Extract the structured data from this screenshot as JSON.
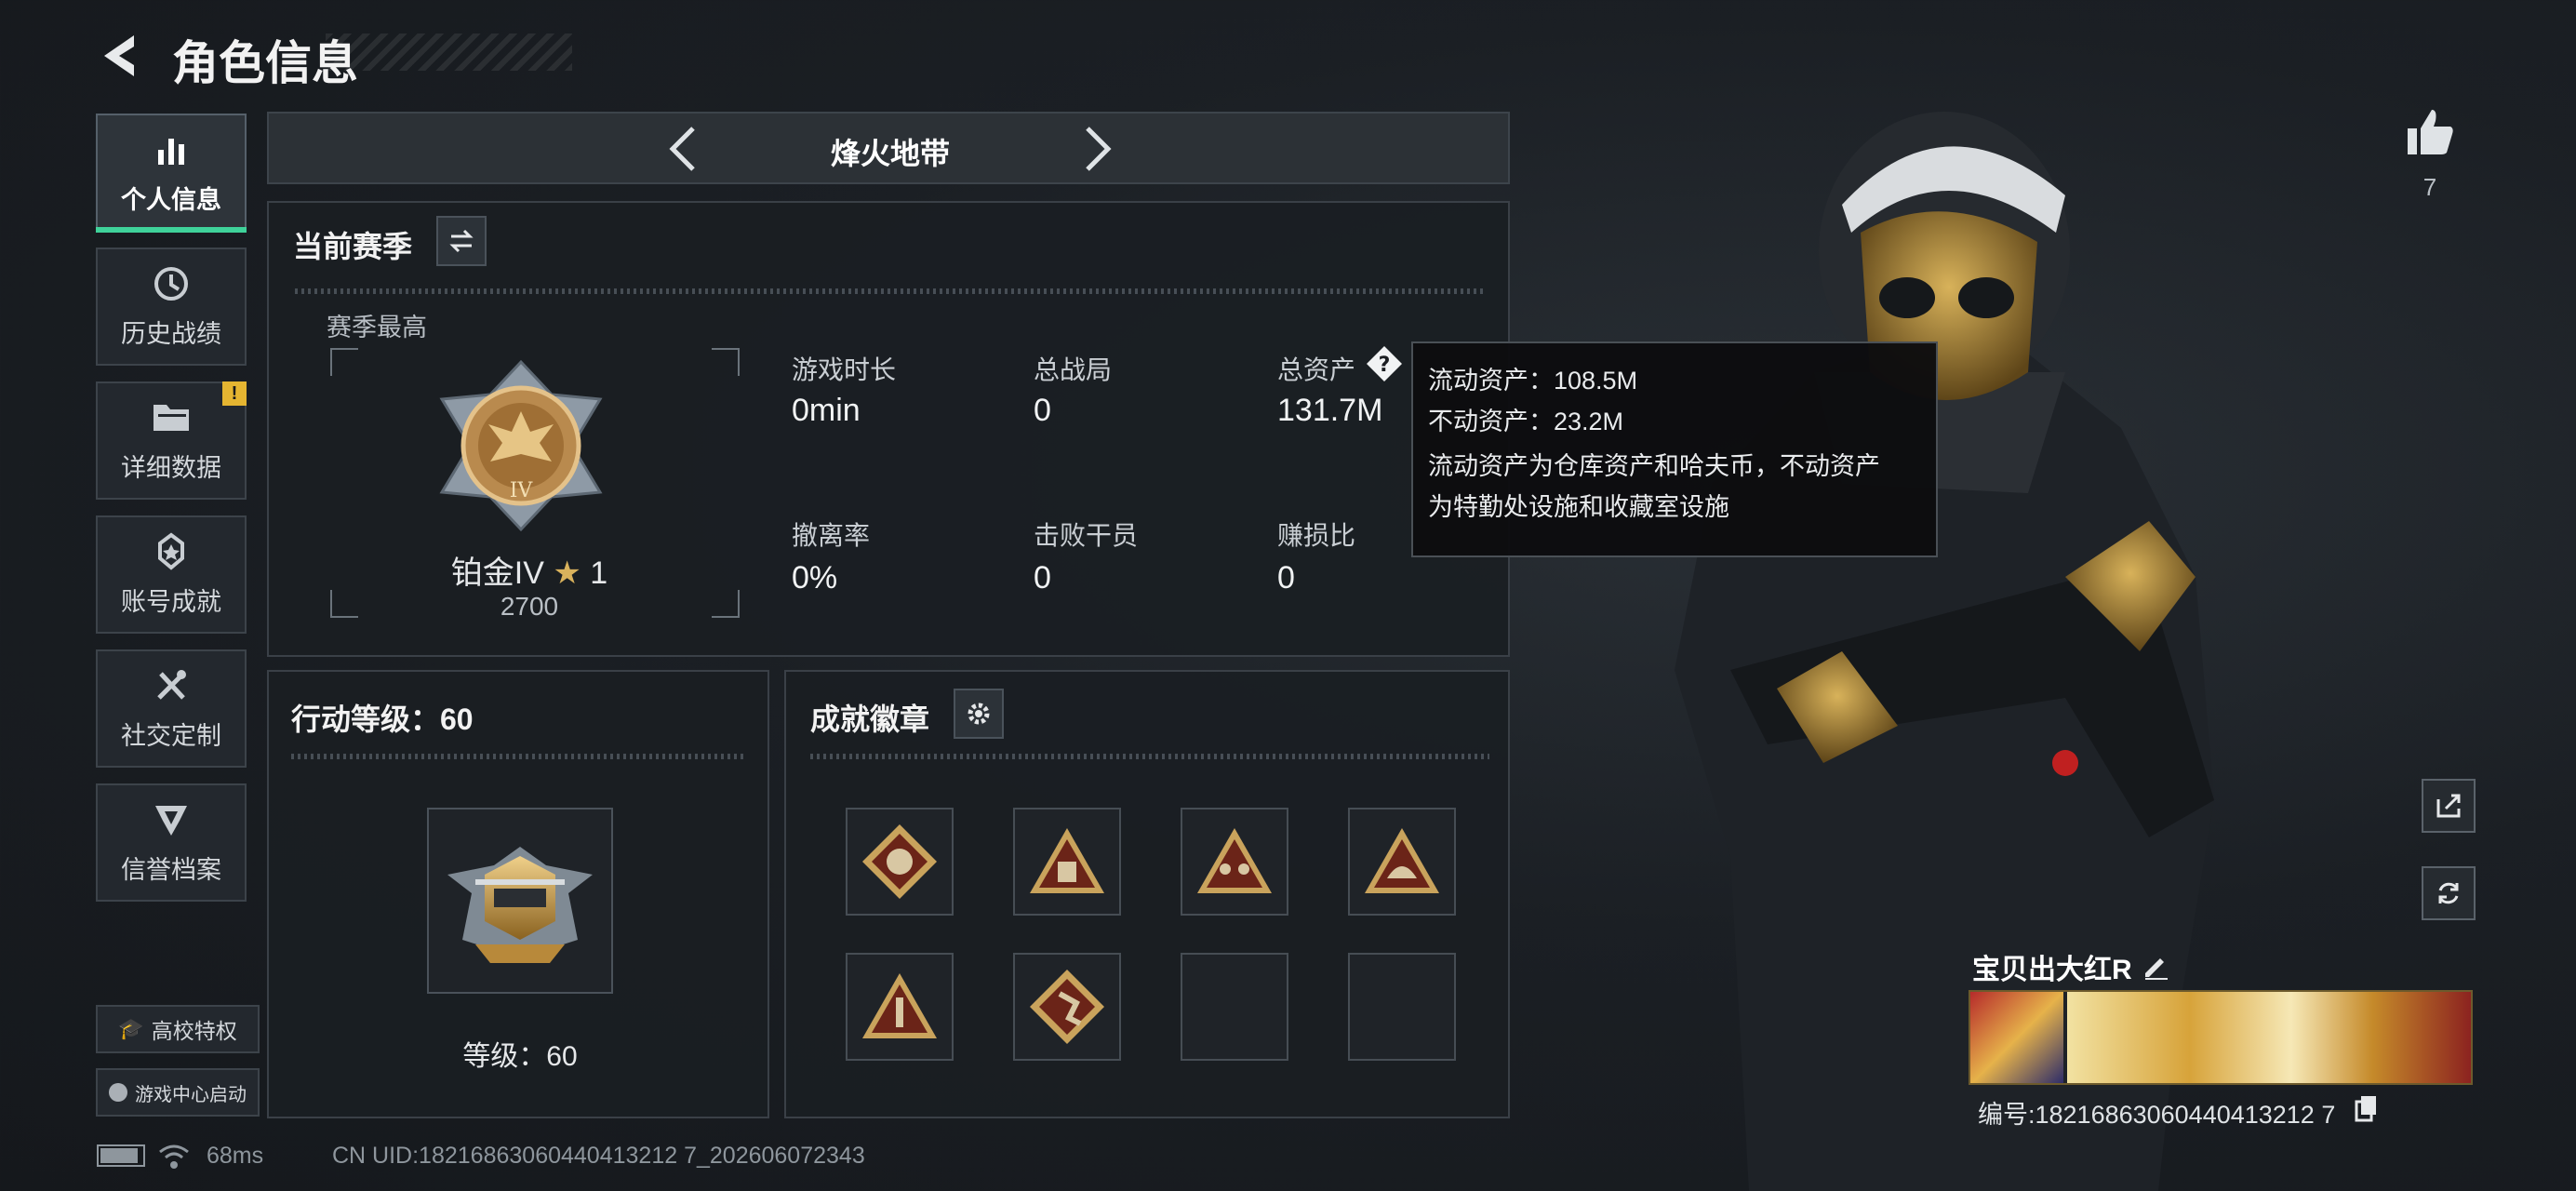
{
  "header": {
    "title": "角色信息"
  },
  "sidebar": {
    "items": [
      {
        "label": "个人信息",
        "icon": "bar-chart-icon",
        "active": true
      },
      {
        "label": "历史战绩",
        "icon": "history-icon"
      },
      {
        "label": "详细数据",
        "icon": "folder-icon",
        "badge": "!"
      },
      {
        "label": "账号成就",
        "icon": "achievement-icon"
      },
      {
        "label": "社交定制",
        "icon": "tools-icon"
      },
      {
        "label": "信誉档案",
        "icon": "reputation-icon"
      }
    ],
    "campus_label": "高校特权",
    "game_center_label": "游戏中心启动"
  },
  "mode": {
    "title": "烽火地带"
  },
  "season": {
    "title": "当前赛季",
    "peak_label": "赛季最高",
    "rank_name": "铂金IV",
    "rank_stars": "1",
    "rank_score": "2700",
    "stats": [
      {
        "label": "游戏时长",
        "value": "0min"
      },
      {
        "label": "总战局",
        "value": "0"
      },
      {
        "label": "总资产",
        "value": "131.7M"
      },
      {
        "label": "撤离率",
        "value": "0%"
      },
      {
        "label": "击败干员",
        "value": "0"
      },
      {
        "label": "赚损比",
        "value": "0"
      }
    ]
  },
  "tooltip": {
    "line1": "流动资产：108.5M",
    "line2": "不动资产：23.2M",
    "line3": "流动资产为仓库资产和哈夫币，不动资产",
    "line4": "为特勤处设施和收藏室设施"
  },
  "action_level": {
    "title": "行动等级：60",
    "level_text": "等级：60"
  },
  "achievement": {
    "title": "成就徽章"
  },
  "right": {
    "likes": "7",
    "player_name": "宝贝出大红R",
    "player_id": "编号:18216863060440413212 7"
  },
  "footer": {
    "ping": "68ms",
    "uid": "CN UID:18216863060440413212 7_202606072343"
  },
  "colors": {
    "accent": "#3fd29a",
    "warning": "#e5b531",
    "gold": "#c79a3e"
  }
}
